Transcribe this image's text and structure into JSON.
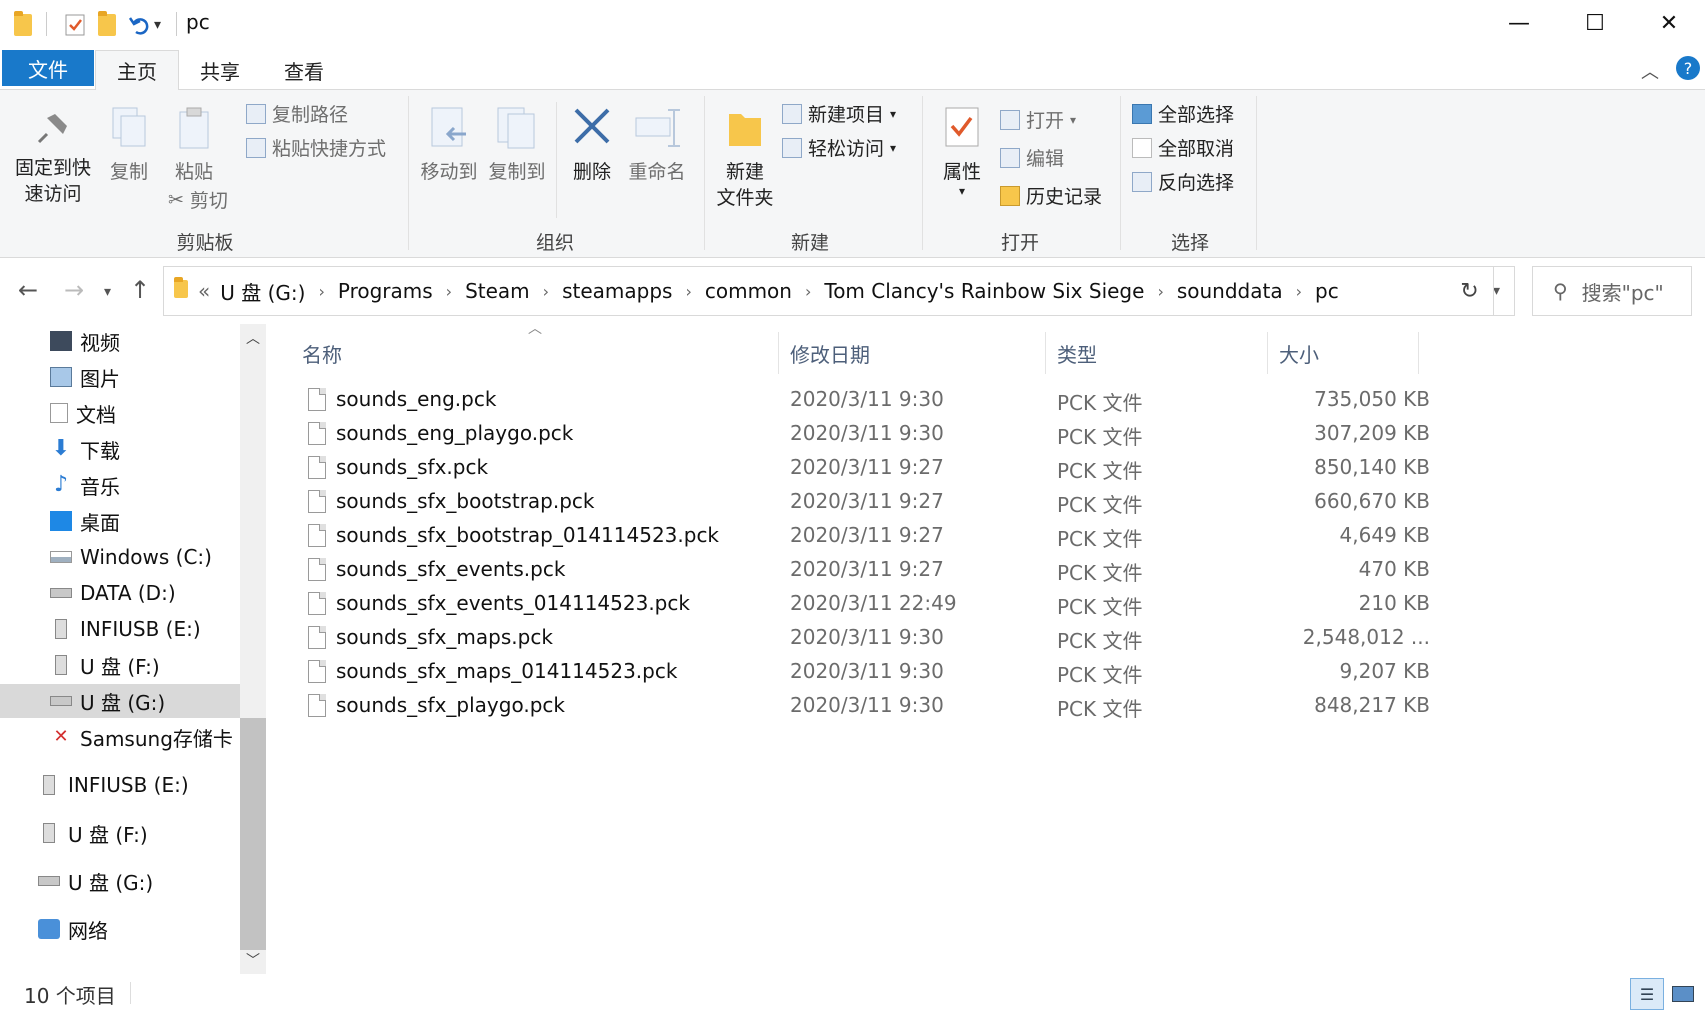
{
  "window": {
    "title": "pc",
    "minimize": "—",
    "maximize": "☐",
    "close": "✕"
  },
  "ribbon_tabs": [
    "文件",
    "主页",
    "共享",
    "查看"
  ],
  "help": "?",
  "ribbon": {
    "clipboard": {
      "pin_label_1": "固定到快",
      "pin_label_2": "速访问",
      "copy": "复制",
      "paste": "粘贴",
      "copy_path": "复制路径",
      "paste_shortcut": "粘贴快捷方式",
      "cut": "剪切",
      "group": "剪贴板"
    },
    "organize": {
      "move_to": "移动到",
      "copy_to": "复制到",
      "delete": "删除",
      "rename": "重命名",
      "group": "组织"
    },
    "new": {
      "new_folder_1": "新建",
      "new_folder_2": "文件夹",
      "new_item": "新建项目",
      "easy_access": "轻松访问",
      "group": "新建"
    },
    "open": {
      "properties": "属性",
      "open": "打开",
      "edit": "编辑",
      "history": "历史记录",
      "group": "打开"
    },
    "select": {
      "select_all": "全部选择",
      "select_none": "全部取消",
      "invert": "反向选择",
      "group": "选择"
    }
  },
  "address": {
    "overflow": "«",
    "crumbs": [
      "U 盘 (G:)",
      "Programs",
      "Steam",
      "steamapps",
      "common",
      "Tom Clancy's Rainbow Six Siege",
      "sounddata",
      "pc"
    ],
    "search_placeholder": "搜索\"pc\""
  },
  "nav": {
    "items": [
      {
        "label": "视频",
        "icon": "video-icon"
      },
      {
        "label": "图片",
        "icon": "pictures-icon"
      },
      {
        "label": "文档",
        "icon": "documents-icon"
      },
      {
        "label": "下载",
        "icon": "download-icon"
      },
      {
        "label": "音乐",
        "icon": "music-icon"
      },
      {
        "label": "桌面",
        "icon": "desktop-icon"
      },
      {
        "label": "Windows (C:)",
        "icon": "windows-drive-icon"
      },
      {
        "label": "DATA (D:)",
        "icon": "drive-icon"
      },
      {
        "label": "INFIUSB (E:)",
        "icon": "usb-drive-icon"
      },
      {
        "label": "U 盘 (F:)",
        "icon": "usb-drive-icon"
      },
      {
        "label": "U 盘 (G:)",
        "icon": "drive-icon",
        "selected": true
      },
      {
        "label": "Samsung存储卡 (",
        "icon": "sd-card-error-icon"
      },
      {
        "label": "INFIUSB (E:)",
        "icon": "usb-drive-icon"
      },
      {
        "label": "U 盘 (F:)",
        "icon": "usb-drive-icon"
      },
      {
        "label": "U 盘 (G:)",
        "icon": "drive-icon"
      },
      {
        "label": "网络",
        "icon": "network-icon"
      }
    ]
  },
  "columns": {
    "name": "名称",
    "date": "修改日期",
    "type": "类型",
    "size": "大小"
  },
  "files": [
    {
      "name": "sounds_eng.pck",
      "date": "2020/3/11 9:30",
      "type": "PCK 文件",
      "size": "735,050 KB"
    },
    {
      "name": "sounds_eng_playgo.pck",
      "date": "2020/3/11 9:30",
      "type": "PCK 文件",
      "size": "307,209 KB"
    },
    {
      "name": "sounds_sfx.pck",
      "date": "2020/3/11 9:27",
      "type": "PCK 文件",
      "size": "850,140 KB"
    },
    {
      "name": "sounds_sfx_bootstrap.pck",
      "date": "2020/3/11 9:27",
      "type": "PCK 文件",
      "size": "660,670 KB"
    },
    {
      "name": "sounds_sfx_bootstrap_014114523.pck",
      "date": "2020/3/11 9:27",
      "type": "PCK 文件",
      "size": "4,649 KB"
    },
    {
      "name": "sounds_sfx_events.pck",
      "date": "2020/3/11 9:27",
      "type": "PCK 文件",
      "size": "470 KB"
    },
    {
      "name": "sounds_sfx_events_014114523.pck",
      "date": "2020/3/11 22:49",
      "type": "PCK 文件",
      "size": "210 KB"
    },
    {
      "name": "sounds_sfx_maps.pck",
      "date": "2020/3/11 9:30",
      "type": "PCK 文件",
      "size": "2,548,012 ..."
    },
    {
      "name": "sounds_sfx_maps_014114523.pck",
      "date": "2020/3/11 9:30",
      "type": "PCK 文件",
      "size": "9,207 KB"
    },
    {
      "name": "sounds_sfx_playgo.pck",
      "date": "2020/3/11 9:30",
      "type": "PCK 文件",
      "size": "848,217 KB"
    }
  ],
  "status": {
    "count": "10 个项目"
  },
  "colors": {
    "file_tab": "#1979ca",
    "selected_nav": "#d9d9d9",
    "header_text": "#4d5f7a"
  }
}
